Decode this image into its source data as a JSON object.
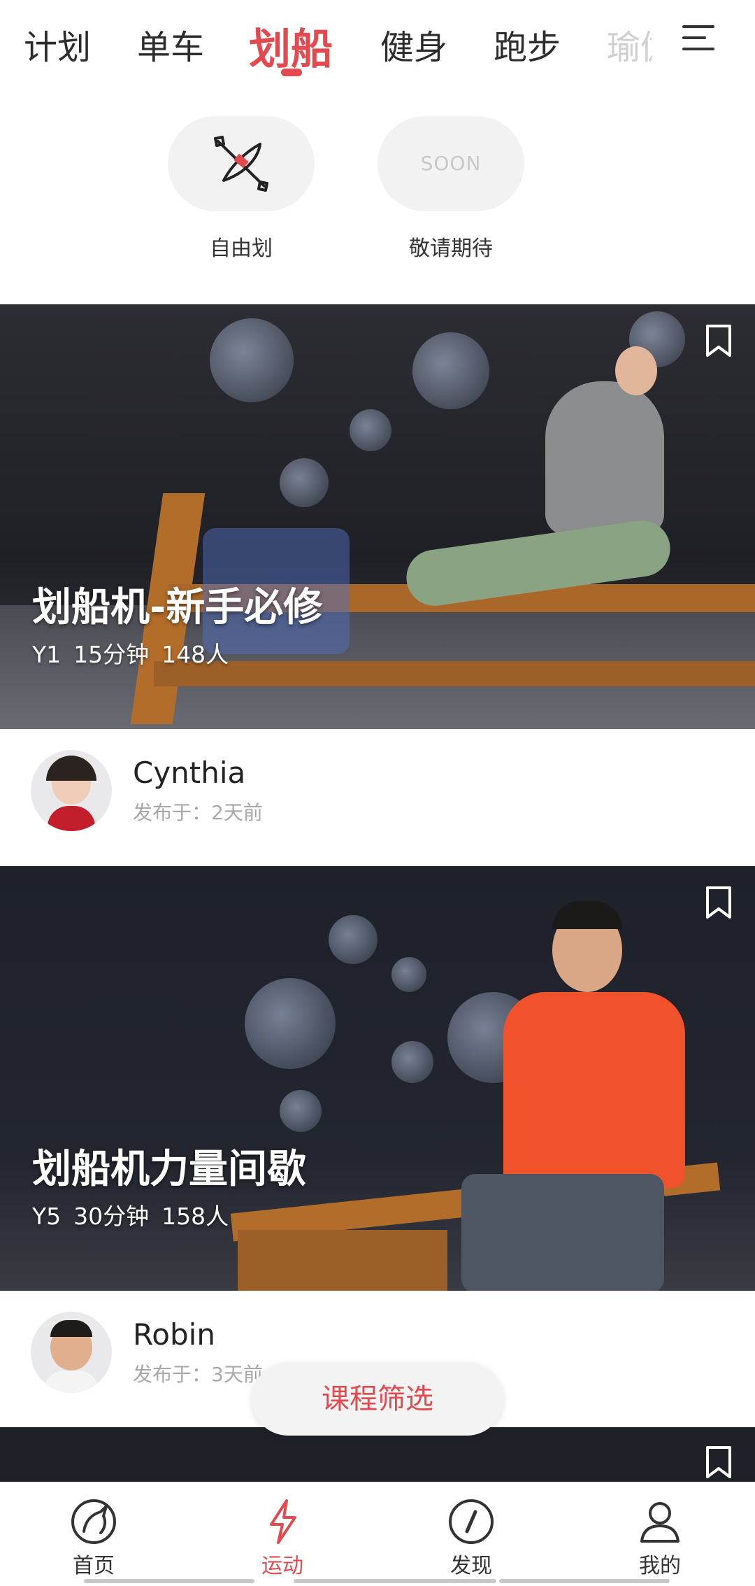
{
  "tabs": [
    {
      "label": "计划"
    },
    {
      "label": "单车"
    },
    {
      "label": "划船",
      "active": true
    },
    {
      "label": "健身"
    },
    {
      "label": "跑步"
    },
    {
      "label": "瑜伽"
    }
  ],
  "modes": [
    {
      "label": "自由划",
      "icon": "kayak-paddle-icon"
    },
    {
      "label": "敬请期待",
      "badge": "SOON"
    }
  ],
  "cards": [
    {
      "title": "划船机-新手必修",
      "level": "Y1",
      "duration": "15分钟",
      "participants": "148人",
      "coach": "Cynthia",
      "published": "发布于：2天前"
    },
    {
      "title": "划船机力量间歇",
      "level": "Y5",
      "duration": "30分钟",
      "participants": "158人",
      "coach": "Robin",
      "published": "发布于：3天前"
    }
  ],
  "filter": {
    "label": "课程筛选"
  },
  "nav": [
    {
      "label": "首页",
      "icon": "unicorn-icon"
    },
    {
      "label": "运动",
      "icon": "lightning-icon",
      "active": true
    },
    {
      "label": "发现",
      "icon": "compass-icon"
    },
    {
      "label": "我的",
      "icon": "user-icon"
    }
  ],
  "colors": {
    "accent": "#e24a4f"
  }
}
